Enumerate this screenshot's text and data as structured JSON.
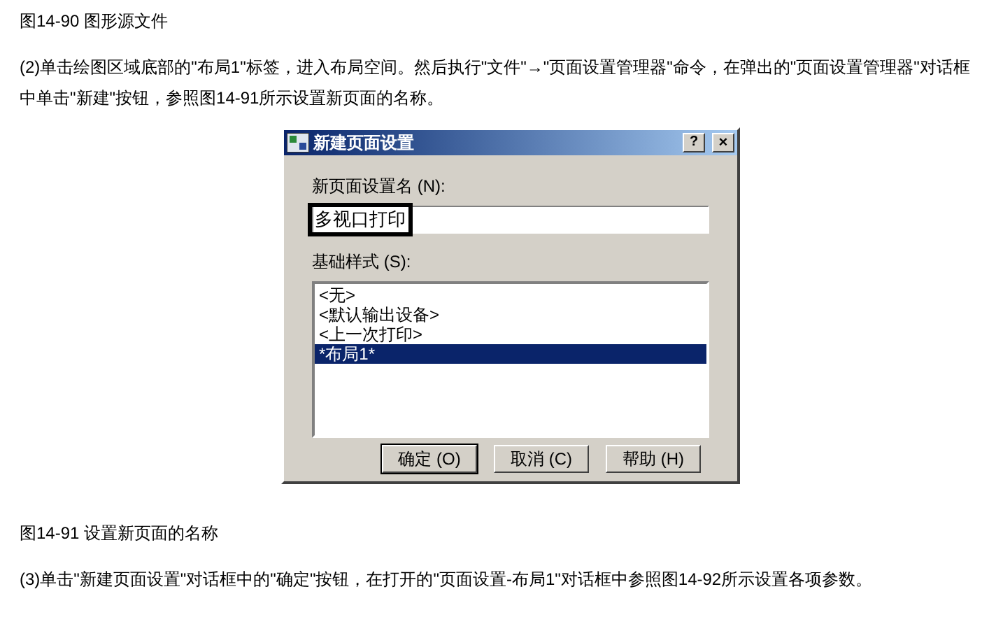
{
  "caption_top": "图14-90 图形源文件",
  "paragraph_1": "(2)单击绘图区域底部的\"布局1\"标签，进入布局空间。然后执行\"文件\"→\"页面设置管理器\"命令，在弹出的\"页面设置管理器\"对话框中单击\"新建\"按钮，参照图14-91所示设置新页面的名称。",
  "dialog": {
    "title": "新建页面设置",
    "help_button": "?",
    "close_button": "×",
    "name_label": "新页面设置名 (N):",
    "name_value": "多视口打印",
    "name_highlighted": true,
    "base_label": "基础样式 (S):",
    "list_items": [
      {
        "label": "<无>",
        "selected": false
      },
      {
        "label": "<默认输出设备>",
        "selected": false
      },
      {
        "label": "<上一次打印>",
        "selected": false
      },
      {
        "label": "*布局1*",
        "selected": true
      }
    ],
    "buttons": [
      {
        "label": "确定 (O)",
        "default": true
      },
      {
        "label": "取消 (C)",
        "default": false
      },
      {
        "label": "帮助 (H)",
        "default": false
      }
    ]
  },
  "caption_bottom": "图14-91 设置新页面的名称",
  "paragraph_2": "(3)单击\"新建页面设置\"对话框中的\"确定\"按钮，在打开的\"页面设置-布局1\"对话框中参照图14-92所示设置各项参数。"
}
